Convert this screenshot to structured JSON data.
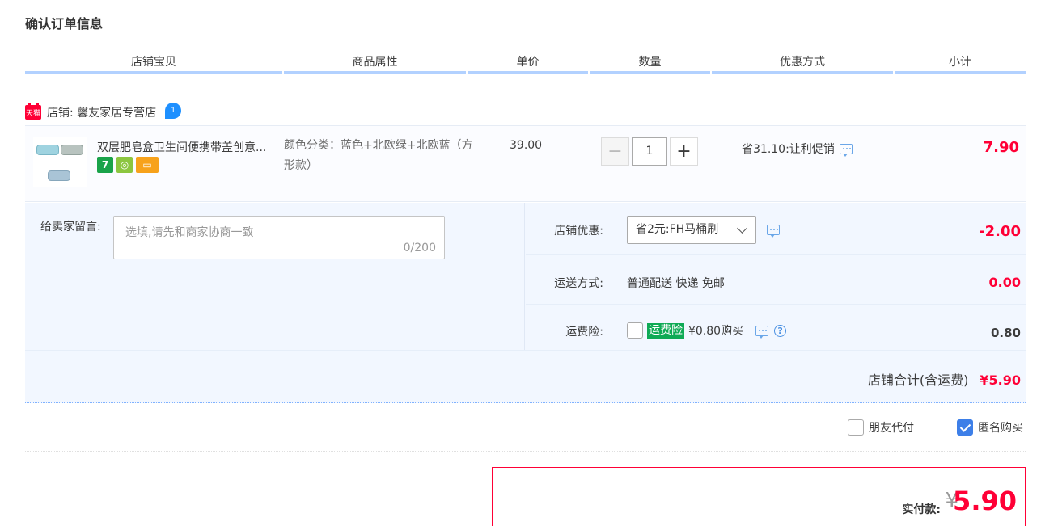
{
  "page": {
    "title": "确认订单信息"
  },
  "table_headers": [
    "店铺宝贝",
    "商品属性",
    "单价",
    "数量",
    "优惠方式",
    "小计"
  ],
  "shop": {
    "badge": "天猫",
    "label": "店铺: 馨友家居专营店",
    "chat_badge": "1"
  },
  "item": {
    "name": "双层肥皂盒卫生间便携带盖创意...",
    "tags": [
      {
        "text": "7",
        "color": "#1aa34a"
      },
      {
        "text": "◎",
        "color": "#8cc63f"
      },
      {
        "text": "▭",
        "color": "#f7a21b"
      }
    ],
    "attr": "颜色分类：蓝色+北欧绿+北欧蓝（方形款）",
    "price": "39.00",
    "qty_minus": "−",
    "quantity": "1",
    "qty_plus": "+",
    "promo": "省31.10:让利促销",
    "subtotal": "7.90"
  },
  "message": {
    "label": "给卖家留言:",
    "placeholder": "选填,请先和商家协商一致",
    "count": "0/200"
  },
  "shop_discount": {
    "label": "店铺优惠:",
    "selected": "省2元:FH马桶刷",
    "value": "-2.00"
  },
  "shipping": {
    "label": "运送方式:",
    "text": "普通配送 快递 免邮",
    "value": "0.00"
  },
  "insurance": {
    "label": "运费险:",
    "tag": "运费险",
    "text": "¥0.80购买",
    "help": "?",
    "value": "0.80"
  },
  "shop_total": {
    "label": "店铺合计(含运费)",
    "value": "¥5.90"
  },
  "options": {
    "friend_pay": "朋友代付",
    "anonymous": "匿名购买"
  },
  "payment": {
    "label": "实付款:",
    "currency": "¥",
    "amount": "5.90"
  }
}
